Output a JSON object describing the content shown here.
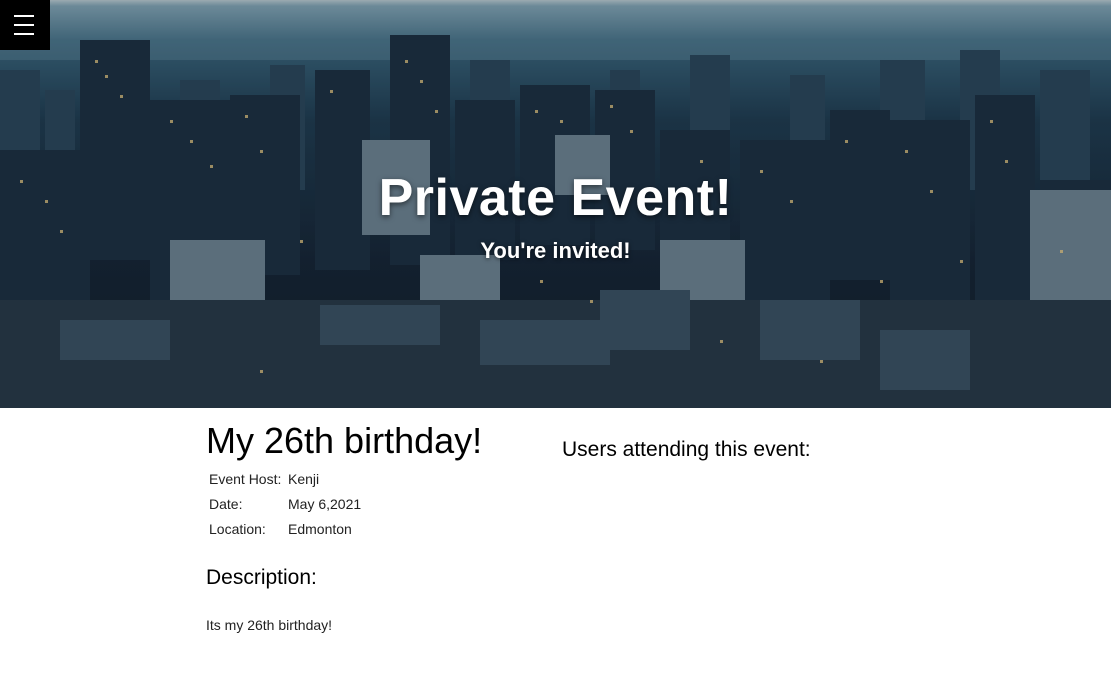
{
  "hero": {
    "title": "Private Event!",
    "subtitle": "You're invited!"
  },
  "menu": {
    "icon": "hamburger-menu-icon"
  },
  "event": {
    "name": "My 26th birthday!",
    "details": [
      {
        "label": "Event Host:",
        "value": "Kenji"
      },
      {
        "label": "Date:",
        "value": "May 6,2021"
      },
      {
        "label": "Location:",
        "value": "Edmonton"
      }
    ],
    "description_heading": "Description:",
    "description_text": "Its my 26th birthday!"
  },
  "attendees": {
    "heading": "Users attending this event:",
    "users": []
  },
  "colors": {
    "menu_background": "#000000",
    "text": "#000000",
    "hero_text": "#ffffff"
  }
}
